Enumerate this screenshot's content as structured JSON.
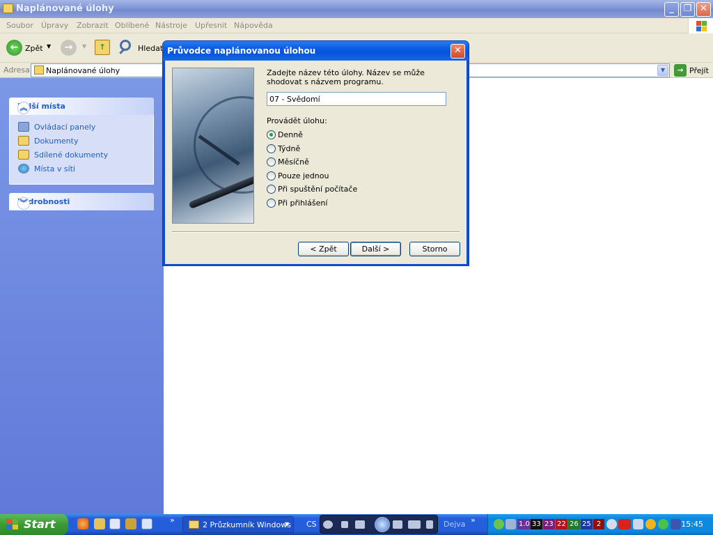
{
  "window": {
    "title": "Naplánované úlohy",
    "controls": {
      "minimize": "_",
      "maximize": "❐",
      "close": "✕"
    }
  },
  "menubar": {
    "items": [
      "Soubor",
      "Úpravy",
      "Zobrazit",
      "Oblíbené",
      "Nástroje",
      "Upřesnit",
      "Nápověda"
    ]
  },
  "toolbar": {
    "back_label": "Zpět",
    "search_label": "Hledat"
  },
  "address": {
    "label": "Adresa",
    "value": "Naplánované úlohy",
    "go_label": "Přejít"
  },
  "leftpane": {
    "places": {
      "title": "Další místa",
      "items": [
        {
          "label": "Ovládací panely",
          "icon": "control-panel-icon"
        },
        {
          "label": "Dokumenty",
          "icon": "documents-folder-icon"
        },
        {
          "label": "Sdílené dokumenty",
          "icon": "shared-folder-icon"
        },
        {
          "label": "Místa v síti",
          "icon": "network-places-icon"
        }
      ]
    },
    "details": {
      "title": "Podrobnosti"
    }
  },
  "dialog": {
    "title": "Průvodce naplánovanou úlohou",
    "prompt": "Zadejte název této úlohy. Název se může shodovat s názvem programu.",
    "task_name": "07 - Svědomí",
    "run_label": "Provádět úlohu:",
    "options": [
      {
        "label": "Denně",
        "selected": true
      },
      {
        "label": "Týdně",
        "selected": false
      },
      {
        "label": "Měsíčně",
        "selected": false
      },
      {
        "label": "Pouze jednou",
        "selected": false
      },
      {
        "label": "Při spuštění počítače",
        "selected": false
      },
      {
        "label": "Při přihlášení",
        "selected": false
      }
    ],
    "buttons": {
      "back": "< Zpět",
      "next": "Další >",
      "cancel": "Storno"
    }
  },
  "taskbar": {
    "start_label": "Start",
    "quicklaunch_more": "»",
    "task_button": "2 Průzkumník Windows",
    "language": "CS",
    "media_label": "Dejva",
    "tray_numbers": [
      "1.0",
      "33",
      "23",
      "22",
      "26",
      "25",
      "2"
    ],
    "clock": "15:45"
  },
  "colors": {
    "xp_blue": "#245edb",
    "start_green": "#3c9a35",
    "dialog_title": "#0a5ae2",
    "link_blue": "#215dc6"
  }
}
